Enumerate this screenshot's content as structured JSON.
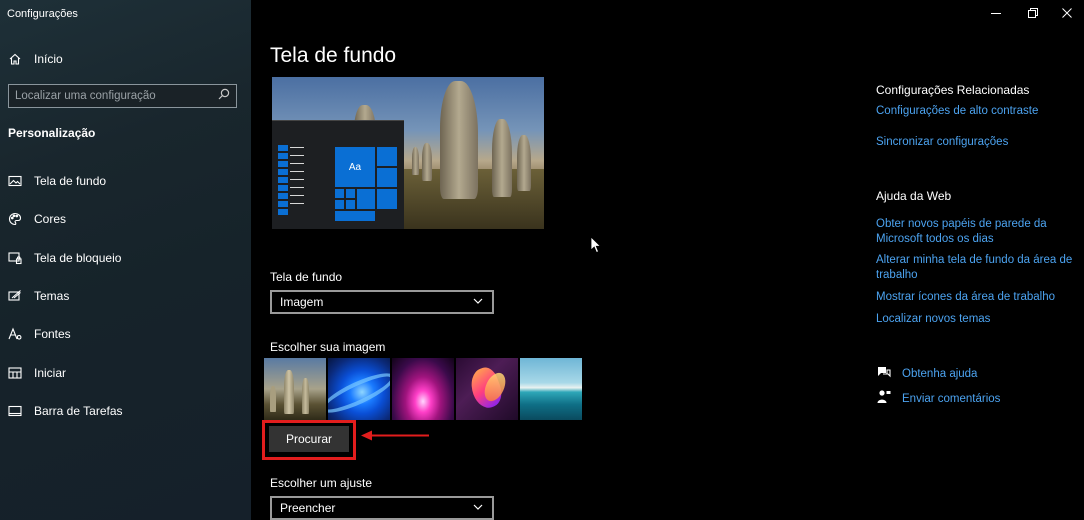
{
  "window": {
    "title": "Configurações",
    "controls": [
      "minimize-icon",
      "restore-icon",
      "close-icon"
    ]
  },
  "sidebar": {
    "home_label": "Início",
    "search_placeholder": "Localizar uma configuração",
    "section_title": "Personalização",
    "items": [
      {
        "label": "Tela de fundo",
        "icon": "image-icon"
      },
      {
        "label": "Cores",
        "icon": "palette-icon"
      },
      {
        "label": "Tela de bloqueio",
        "icon": "lock-screen-icon"
      },
      {
        "label": "Temas",
        "icon": "themes-icon"
      },
      {
        "label": "Fontes",
        "icon": "fonts-icon"
      },
      {
        "label": "Iniciar",
        "icon": "start-icon"
      },
      {
        "label": "Barra de Tarefas",
        "icon": "taskbar-icon"
      }
    ]
  },
  "main": {
    "title": "Tela de fundo",
    "preview_tile_text": "Aa",
    "background_label": "Tela de fundo",
    "background_value": "Imagem",
    "choose_image_label": "Escolher sua imagem",
    "browse_label": "Procurar",
    "fit_label": "Escolher um ajuste",
    "fit_value": "Preencher"
  },
  "related": {
    "heading": "Configurações Relacionadas",
    "links": [
      "Configurações de alto contraste",
      "Sincronizar configurações"
    ]
  },
  "web_help": {
    "heading": "Ajuda da Web",
    "links": [
      "Obter novos papéis de parede da Microsoft todos os dias",
      "Alterar minha tela de fundo da área de trabalho",
      "Mostrar ícones da área de trabalho",
      "Localizar novos temas"
    ]
  },
  "help": {
    "get_help": "Obtenha ajuda",
    "feedback": "Enviar comentários"
  },
  "colors": {
    "accent": "#0a6fd4",
    "link": "#4ca3f0",
    "annotation": "#e21d1d"
  }
}
